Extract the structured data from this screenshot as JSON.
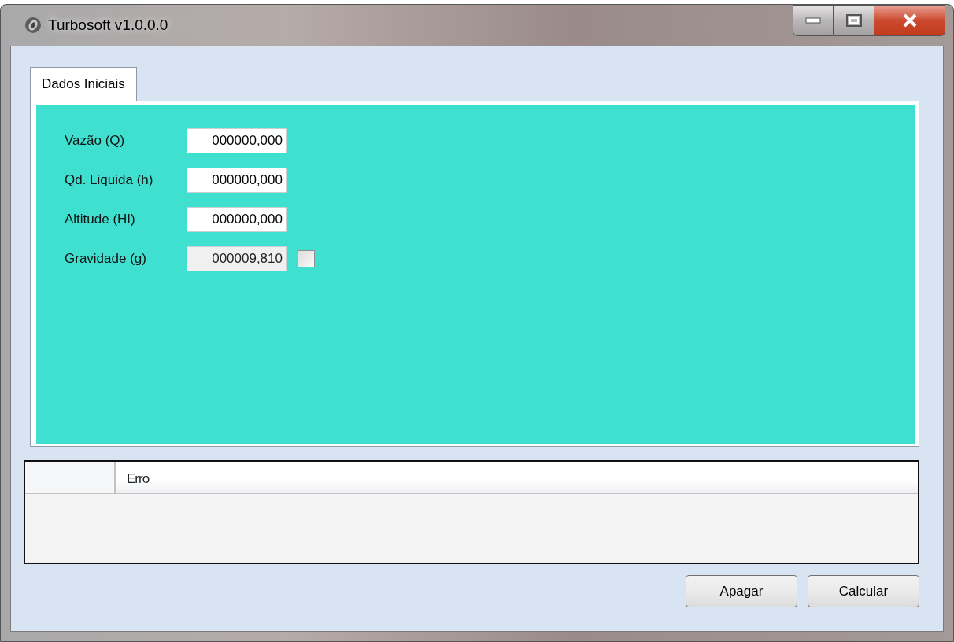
{
  "window": {
    "title": "Turbosoft v1.0.0.0"
  },
  "tabs": [
    {
      "label": "Dados Iniciais",
      "selected": true
    }
  ],
  "fields": [
    {
      "label": "Vazão (Q)",
      "value": "000000,000",
      "disabled": false
    },
    {
      "label": "Qd. Liquida (h)",
      "value": "000000,000",
      "disabled": false
    },
    {
      "label": "Altitude (HI)",
      "value": "000000,000",
      "disabled": false
    },
    {
      "label": "Gravidade (g)",
      "value": "000009,810",
      "disabled": true,
      "checkbox": {
        "checked": false
      }
    }
  ],
  "grid": {
    "columns": [
      "Erro"
    ]
  },
  "buttons": [
    "Apagar",
    "Calcular"
  ]
}
